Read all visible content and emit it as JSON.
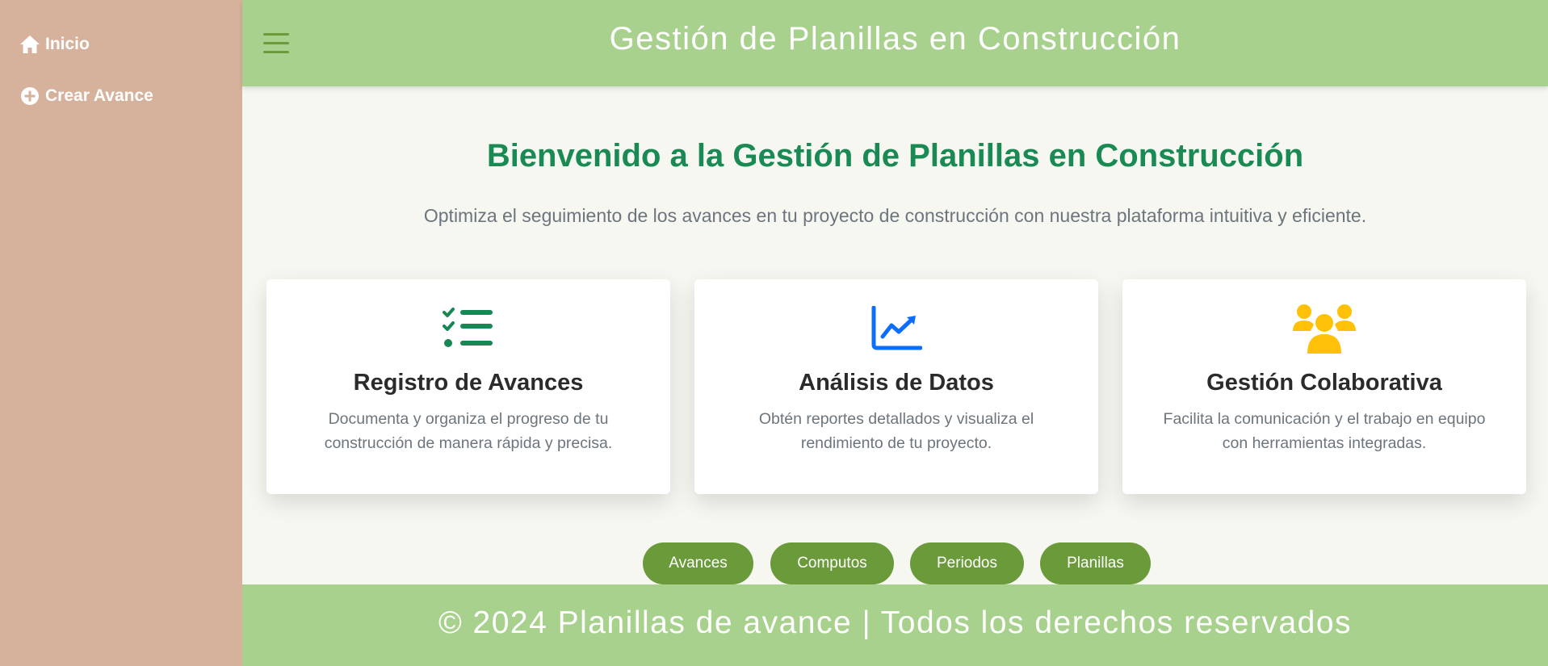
{
  "sidebar": {
    "items": [
      {
        "label": "Inicio",
        "icon": "home-icon"
      },
      {
        "label": "Crear Avance",
        "icon": "plus-circle-icon"
      }
    ]
  },
  "header": {
    "title": "Gestión de Planillas en Construcción",
    "menu_icon": "hamburger-menu-icon"
  },
  "main": {
    "welcome": "Bienvenido a la Gestión de Planillas en Construcción",
    "subtitle": "Optimiza el seguimiento de los avances en tu proyecto de construcción con nuestra plataforma intuitiva y eficiente.",
    "cards": [
      {
        "icon": "checklist-icon",
        "icon_color": "#198754",
        "title": "Registro de Avances",
        "description": "Documenta y organiza el progreso de tu construcción de manera rápida y precisa."
      },
      {
        "icon": "line-chart-icon",
        "icon_color": "#0d6efd",
        "title": "Análisis de Datos",
        "description": "Obtén reportes detallados y visualiza el rendimiento de tu proyecto."
      },
      {
        "icon": "people-group-icon",
        "icon_color": "#ffc107",
        "title": "Gestión Colaborativa",
        "description": "Facilita la comunicación y el trabajo en equipo con herramientas integradas."
      }
    ],
    "buttons": [
      "Avances",
      "Computos",
      "Periodos",
      "Planillas"
    ]
  },
  "footer": {
    "text": "© 2024 Planillas de avance | Todos los derechos reservados"
  },
  "colors": {
    "sidebar_bg": "#d6b29c",
    "header_bg": "#a8d18d",
    "accent_green": "#6a9a3a",
    "welcome_green": "#1a8a55"
  }
}
